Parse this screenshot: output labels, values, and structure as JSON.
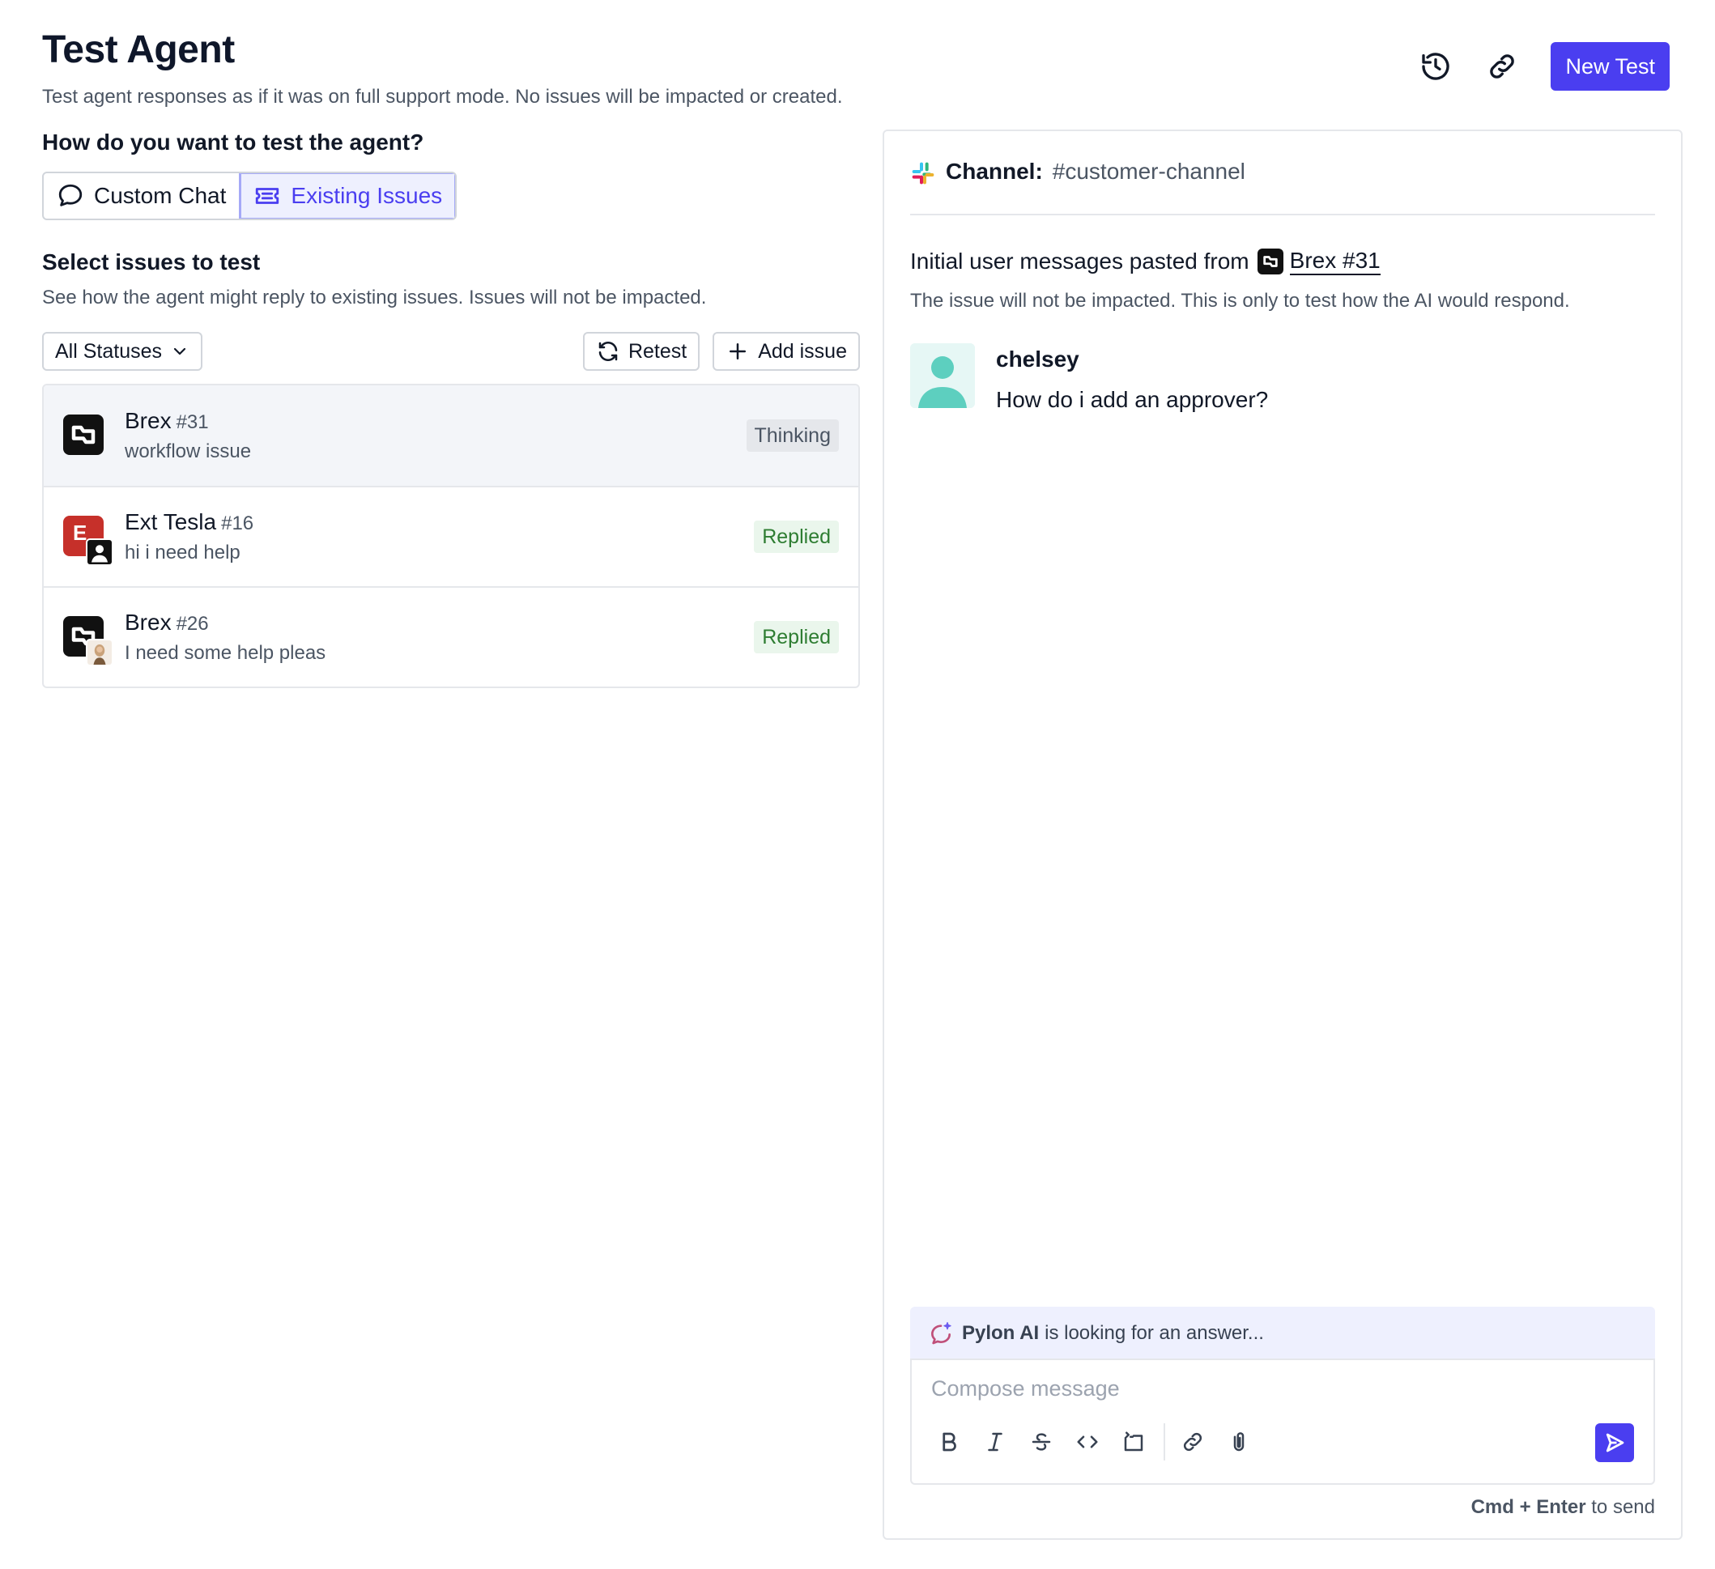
{
  "header": {
    "title": "Test Agent",
    "subtitle": "Test agent responses as if it was on full support mode. No issues will be impacted or created.",
    "new_test_label": "New Test",
    "history_icon": "history-icon",
    "link_icon": "link-icon"
  },
  "mode": {
    "question": "How do you want to test the agent?",
    "options": [
      {
        "label": "Custom Chat",
        "icon": "chat-bubble-icon",
        "active": false
      },
      {
        "label": "Existing Issues",
        "icon": "ticket-icon",
        "active": true
      }
    ]
  },
  "issues_section": {
    "title": "Select issues to test",
    "description": "See how the agent might reply to existing issues. Issues will not be impacted.",
    "status_filter": "All Statuses",
    "retest_label": "Retest",
    "add_issue_label": "Add issue",
    "items": [
      {
        "org": "Brex",
        "number": "#31",
        "summary": "workflow issue",
        "status": "Thinking",
        "selected": true
      },
      {
        "org": "Ext Tesla",
        "number": "#16",
        "summary": "hi i need help",
        "status": "Replied",
        "selected": false
      },
      {
        "org": "Brex",
        "number": "#26",
        "summary": "I need some help pleas",
        "status": "Replied",
        "selected": false
      }
    ]
  },
  "chat": {
    "channel_label": "Channel:",
    "channel_name": "#customer-channel",
    "initial_prefix": "Initial user messages pasted from",
    "initial_issue_link": "Brex #31",
    "note": "The issue will not be impacted. This is only to test how the AI would respond.",
    "message": {
      "author": "chelsey",
      "body": "How do i add an approver?"
    },
    "ai_status_name": "Pylon AI",
    "ai_status_text": "is looking for an answer...",
    "composer_placeholder": "Compose message",
    "hint_keys": "Cmd + Enter",
    "hint_suffix": "to send"
  },
  "colors": {
    "accent": "#4a3ef0",
    "replied_text": "#2e7d32",
    "replied_bg": "#eaf6ec",
    "thinking_bg": "#e5e7eb",
    "ai_bar_bg": "#eef0fe",
    "tesla_red": "#c6302a"
  }
}
